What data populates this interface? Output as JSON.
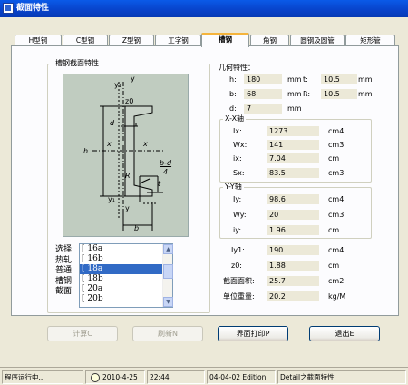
{
  "window": {
    "title": "截面特性"
  },
  "tabs": [
    "H型钢",
    "C型钢",
    "Z型钢",
    "工字钢",
    "槽钢",
    "角钢",
    "圆钢及圆管",
    "矩形管"
  ],
  "active_tab": "槽钢",
  "section_group": "槽钢截面特性",
  "geo": {
    "title": "几何特性：",
    "h": {
      "label": "h:",
      "value": "180",
      "unit": "mm"
    },
    "t": {
      "label": "t:",
      "value": "10.5",
      "unit": "mm"
    },
    "b": {
      "label": "b:",
      "value": "68",
      "unit": "mm"
    },
    "R": {
      "label": "R:",
      "value": "10.5",
      "unit": "mm"
    },
    "d": {
      "label": "d:",
      "value": "7",
      "unit": "mm"
    }
  },
  "xx": {
    "title": "X-X轴",
    "Ix": {
      "label": "Ix:",
      "value": "1273",
      "unit": "cm4"
    },
    "Wx": {
      "label": "Wx:",
      "value": "141",
      "unit": "cm3"
    },
    "ix": {
      "label": "ix:",
      "value": "7.04",
      "unit": "cm"
    },
    "Sx": {
      "label": "Sx:",
      "value": "83.5",
      "unit": "cm3"
    }
  },
  "yy": {
    "title": "Y-Y轴",
    "Iy": {
      "label": "Iy:",
      "value": "98.6",
      "unit": "cm4"
    },
    "Wy": {
      "label": "Wy:",
      "value": "20",
      "unit": "cm3"
    },
    "iy": {
      "label": "iy:",
      "value": "1.96",
      "unit": "cm"
    }
  },
  "other": {
    "Iy1": {
      "label": "Iy1:",
      "value": "190",
      "unit": "cm4"
    },
    "z0": {
      "label": "z0:",
      "value": "1.88",
      "unit": "cm"
    },
    "area": {
      "label": "截面面积:",
      "value": "25.7",
      "unit": "cm2"
    },
    "weight": {
      "label": "单位重量:",
      "value": "20.2",
      "unit": "kg/M"
    }
  },
  "diagram_labels": {
    "y_top": "y",
    "y1_top": "y₁",
    "z0": "z0",
    "d": "d",
    "x_left": "x",
    "x_right": "x",
    "h": "h",
    "R": "R",
    "t": "t",
    "bd4": "b-d",
    "four": "4",
    "y1_bot": "y₁",
    "y_bot": "y",
    "b": "b"
  },
  "select_label": "选择热轧普通槽钢截面",
  "list": [
    "[ 16a",
    "[ 16b",
    "[ 18a",
    "[ 18b",
    "[ 20a",
    "[ 20b"
  ],
  "list_selected": "[ 18a",
  "buttons": {
    "calc": "计算C",
    "refresh": "刷新N",
    "print": "界面打印P",
    "exit": "退出E"
  },
  "status": {
    "running": "程序运行中...",
    "date": "2010-4-25",
    "time": "22:44",
    "edition": "04-04-02 Edition",
    "detail": "Detail之截面特性"
  }
}
